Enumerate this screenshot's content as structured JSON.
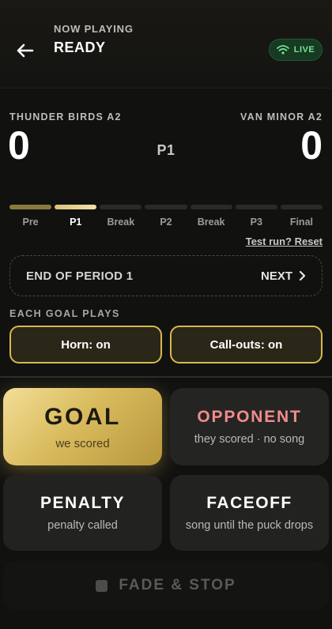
{
  "header": {
    "now_label": "NOW PLAYING",
    "status": "READY",
    "live_label": "LIVE",
    "back_icon": "arrow-left-icon",
    "live_icon": "wifi-icon"
  },
  "scoreboard": {
    "home_team": "THUNDER BIRDS A2",
    "away_team": "VAN MINOR A2",
    "home_score": "0",
    "away_score": "0",
    "current_period": "P1"
  },
  "periods": [
    {
      "label": "Pre",
      "state": "done"
    },
    {
      "label": "P1",
      "state": "current"
    },
    {
      "label": "Break",
      "state": "upcoming"
    },
    {
      "label": "P2",
      "state": "upcoming"
    },
    {
      "label": "Break",
      "state": "upcoming"
    },
    {
      "label": "P3",
      "state": "upcoming"
    },
    {
      "label": "Final",
      "state": "upcoming"
    }
  ],
  "test_run_label": "Test run? Reset",
  "end_period": {
    "title": "END OF PERIOD 1",
    "next_label": "NEXT",
    "next_icon": "chevron-right-icon"
  },
  "goal_settings": {
    "section_label": "EACH GOAL PLAYS",
    "horn": "Horn: on",
    "callouts": "Call-outs: on"
  },
  "actions": {
    "goal": {
      "title": "GOAL",
      "subtitle": "we scored"
    },
    "opponent": {
      "title": "OPPONENT",
      "subtitle": "they scored · no song"
    },
    "penalty": {
      "title": "PENALTY",
      "subtitle": "penalty called"
    },
    "faceoff": {
      "title": "FACEOFF",
      "subtitle": "song until the puck drops"
    }
  },
  "fade_stop": {
    "label": "FADE & STOP",
    "icon": "stop-square-icon"
  },
  "colors": {
    "accent_gold": "#d9bb5d",
    "live_green": "#7be08f",
    "opponent_red": "#f08c8c",
    "background": "#111110"
  }
}
